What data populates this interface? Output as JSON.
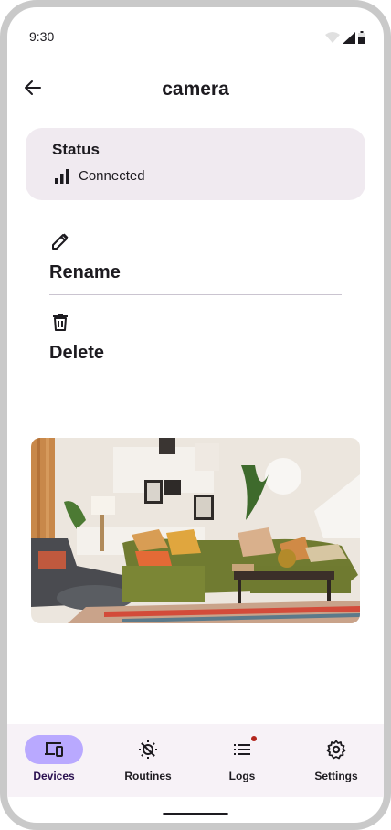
{
  "statusbar": {
    "time": "9:30"
  },
  "appbar": {
    "title": "camera",
    "back_icon": "arrow-back-icon"
  },
  "status_card": {
    "title": "Status",
    "connection_text": "Connected",
    "icon": "signal-bars-icon"
  },
  "actions": [
    {
      "label": "Rename",
      "icon": "pencil-icon"
    },
    {
      "label": "Delete",
      "icon": "trash-icon"
    }
  ],
  "camera_feed": {
    "description_icon": "camera-feed-image"
  },
  "nav": {
    "items": [
      {
        "label": "Devices",
        "icon": "devices-icon",
        "active": true
      },
      {
        "label": "Routines",
        "icon": "routines-icon",
        "active": false
      },
      {
        "label": "Logs",
        "icon": "logs-icon",
        "active": false,
        "badge": true
      },
      {
        "label": "Settings",
        "icon": "gear-icon",
        "active": false
      }
    ]
  },
  "colors": {
    "accent": "#b9a9ff",
    "card_bg": "#f0eaf0",
    "nav_bg": "#f7f2f7",
    "badge": "#b3261e"
  }
}
